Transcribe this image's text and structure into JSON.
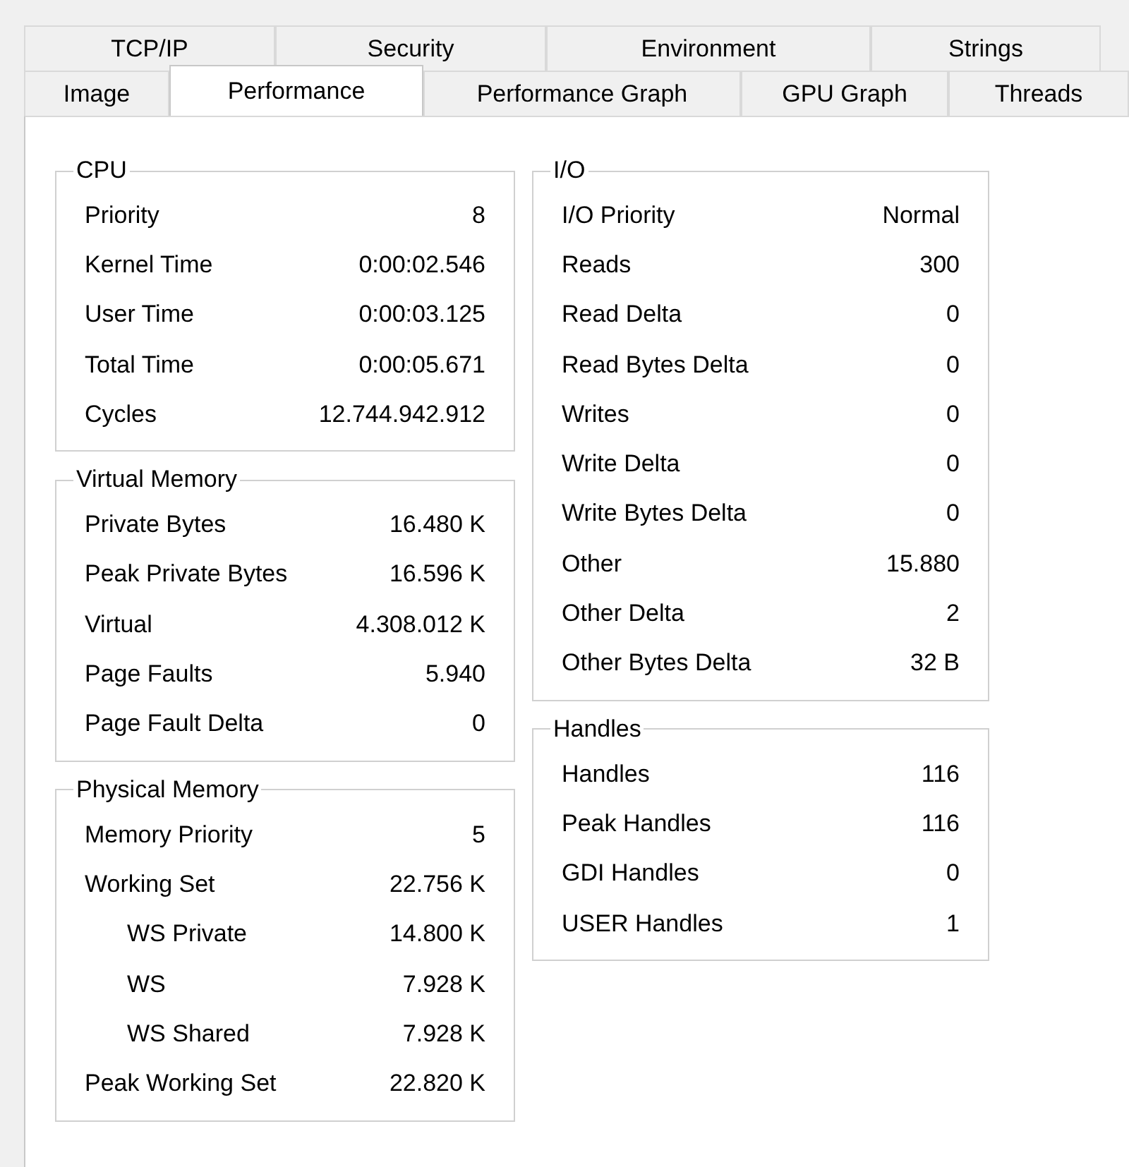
{
  "tab_rows": [
    [
      {
        "label": "TCP/IP",
        "selected": false
      },
      {
        "label": "Security",
        "selected": false
      },
      {
        "label": "Environment",
        "selected": false
      },
      {
        "label": "Strings",
        "selected": false
      }
    ],
    [
      {
        "label": "Image",
        "selected": false
      },
      {
        "label": "Performance",
        "selected": true
      },
      {
        "label": "Performance Graph",
        "selected": false
      },
      {
        "label": "GPU Graph",
        "selected": false
      },
      {
        "label": "Threads",
        "selected": false
      }
    ]
  ],
  "columns": [
    [
      {
        "title": "CPU",
        "rows": [
          {
            "label": "Priority",
            "value": "8"
          },
          {
            "label": "Kernel Time",
            "value": "0:00:02.546"
          },
          {
            "label": "User Time",
            "value": "0:00:03.125"
          },
          {
            "label": "Total Time",
            "value": "0:00:05.671"
          },
          {
            "label": "Cycles",
            "value": "12.744.942.912"
          }
        ]
      },
      {
        "title": "Virtual Memory",
        "rows": [
          {
            "label": "Private Bytes",
            "value": "16.480 K"
          },
          {
            "label": "Peak Private Bytes",
            "value": "16.596 K"
          },
          {
            "label": "Virtual",
            "value": "4.308.012 K"
          },
          {
            "label": "Page Faults",
            "value": "5.940"
          },
          {
            "label": "Page Fault Delta",
            "value": "0"
          }
        ]
      },
      {
        "title": "Physical Memory",
        "rows": [
          {
            "label": "Memory Priority",
            "value": "5"
          },
          {
            "label": "Working Set",
            "value": "22.756 K",
            "children": [
              {
                "label": "WS Private",
                "value": "14.800 K"
              },
              {
                "label": "WS",
                "value": "7.928 K"
              },
              {
                "label": "WS Shared",
                "value": "7.928 K"
              }
            ]
          },
          {
            "label": "Peak Working Set",
            "value": "22.820 K"
          }
        ]
      }
    ],
    [
      {
        "title": "I/O",
        "rows": [
          {
            "label": "I/O Priority",
            "value": "Normal"
          },
          {
            "label": "Reads",
            "value": "300"
          },
          {
            "label": "Read Delta",
            "value": "0"
          },
          {
            "label": "Read Bytes Delta",
            "value": "0"
          },
          {
            "label": "Writes",
            "value": "0"
          },
          {
            "label": "Write Delta",
            "value": "0"
          },
          {
            "label": "Write Bytes Delta",
            "value": "0"
          },
          {
            "label": "Other",
            "value": "15.880"
          },
          {
            "label": "Other Delta",
            "value": "2"
          },
          {
            "label": "Other Bytes Delta",
            "value": "32 B"
          }
        ]
      },
      {
        "title": "Handles",
        "rows": [
          {
            "label": "Handles",
            "value": "116"
          },
          {
            "label": "Peak Handles",
            "value": "116"
          },
          {
            "label": "GDI Handles",
            "value": "0"
          },
          {
            "label": "USER Handles",
            "value": "1"
          }
        ]
      }
    ]
  ]
}
